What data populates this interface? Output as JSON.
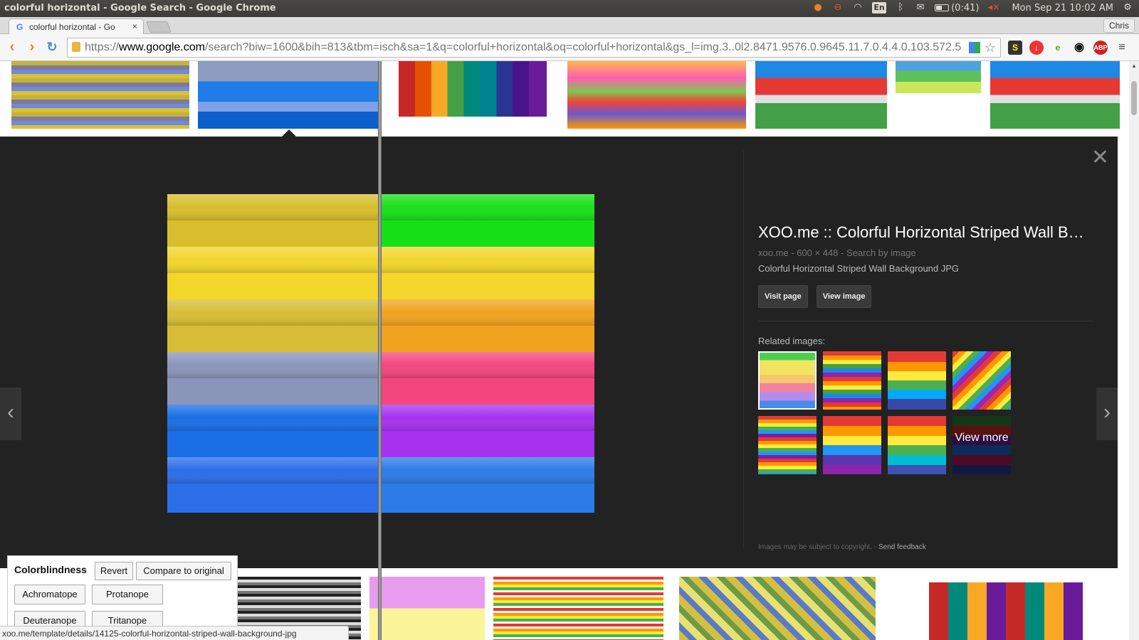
{
  "os": {
    "window_title": "colorful horizontal - Google Search - Google Chrome",
    "language": "En",
    "battery": "(0:41)",
    "clock": "Mon Sep 21 10:02 AM"
  },
  "browser": {
    "tab_title": "colorful horizontal - Go",
    "tab_close": "×",
    "user": "Chris",
    "url_proto": "https://",
    "url_host": "www.google.com",
    "url_path": "/search?biw=1600&bih=813&tbm=isch&sa=1&q=colorful+horizontal&oq=colorful+horizontal&gs_l=img.3..0l2.8471.9576.0.9645.11.7.0.4.4.0.103.572.5"
  },
  "viewer": {
    "title": "XOO.me :: Colorful Horizontal Striped Wall B…",
    "meta_domain": "xoo.me",
    "meta_dims": "600 × 448",
    "meta_search": "Search by image",
    "description": "Colorful Horizontal Striped Wall Background JPG",
    "visit_page": "Visit page",
    "view_image": "View image",
    "related_label": "Related images:",
    "view_more": "View more",
    "copyright": "Images may be subject to copyright.",
    "send_feedback": "Send feedback"
  },
  "colorblind": {
    "title": "Colorblindness",
    "revert": "Revert",
    "compare": "Compare to original",
    "achromatope": "Achromatope",
    "protanope": "Protanope",
    "deuteranope": "Deuteranope",
    "tritanope": "Tritanope"
  },
  "status_url": "xoo.me/template/details/14125-colorful-horizontal-striped-wall-background-jpg",
  "colors": {
    "panel_bg": "#222222",
    "link_orange": "#e07b39",
    "accent_blue": "#4a8ad8"
  }
}
